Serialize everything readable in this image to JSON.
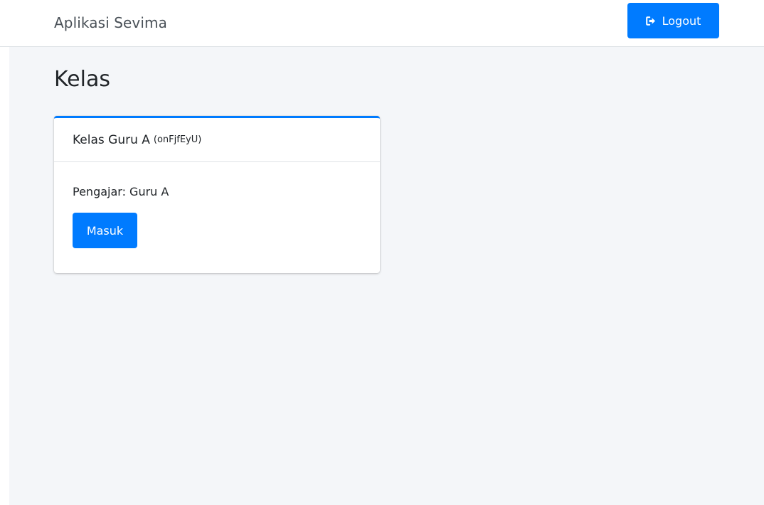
{
  "navbar": {
    "brand": "Aplikasi Sevima",
    "logout_label": "Logout",
    "logout_icon": "sign-out-icon"
  },
  "page": {
    "title": "Kelas"
  },
  "classes": [
    {
      "name": "Kelas Guru A",
      "code": "(onFjfEyU)",
      "teacher": "Pengajar: Guru A",
      "enter_label": "Masuk"
    }
  ],
  "colors": {
    "primary": "#007bff",
    "content_background": "#f4f6f9"
  }
}
